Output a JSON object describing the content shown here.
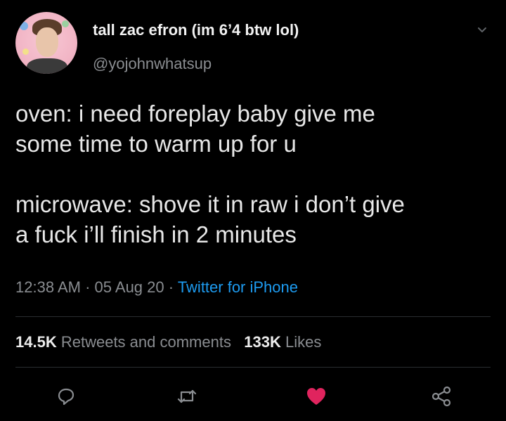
{
  "tweet": {
    "display_name": "tall zac efron (im 6’4 btw lol)",
    "handle": "@yojohnwhatsup",
    "text": "oven: i need foreplay baby give me\nsome time to warm up for u\n\nmicrowave: shove it in raw i don’t give\na fuck i’ll finish in 2 minutes",
    "time": "12:38 AM",
    "separator": "·",
    "date": "05 Aug 20",
    "source": "Twitter for iPhone"
  },
  "stats": {
    "retweets_count": "14.5K",
    "retweets_label": "Retweets and comments",
    "likes_count": "133K",
    "likes_label": "Likes"
  },
  "actions": {
    "icons": [
      "reply-icon",
      "retweet-icon",
      "like-icon",
      "share-icon"
    ],
    "liked": true
  },
  "colors": {
    "background": "#000000",
    "link": "#1d9bf0",
    "like": "#e0245e",
    "muted": "#8a8d91"
  }
}
